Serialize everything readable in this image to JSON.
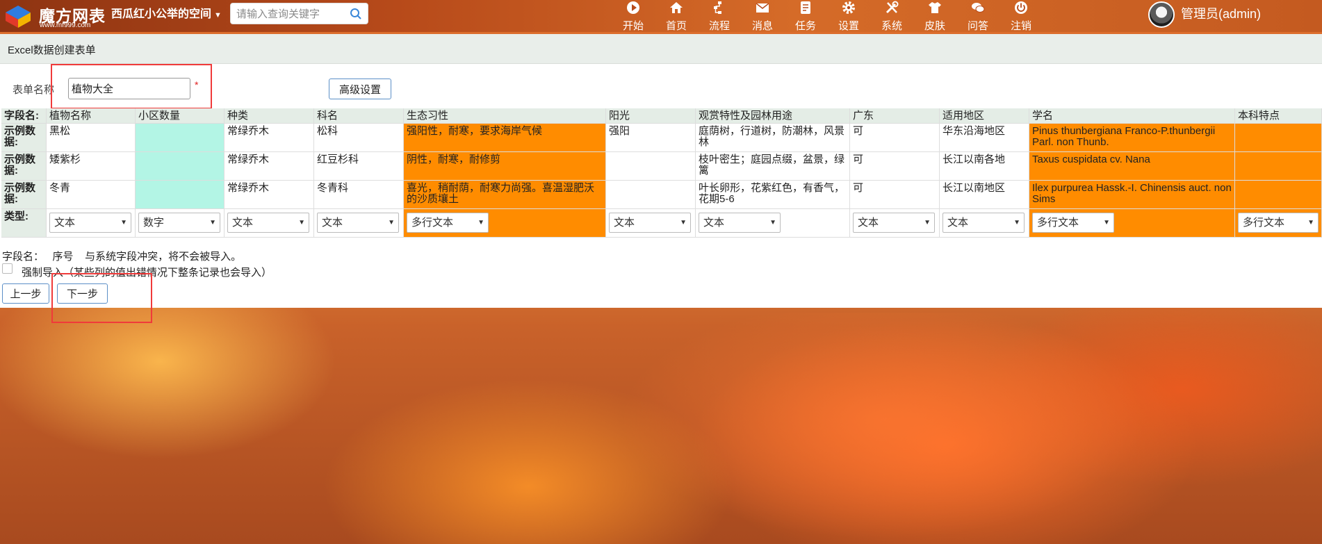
{
  "app": {
    "logo_title": "魔方网表",
    "logo_url": "www.mf999.com",
    "space_name": "西瓜红小公举的空间",
    "search_placeholder": "请输入查询关键字",
    "user_name": "管理员(admin)"
  },
  "nav": [
    {
      "label": "开始",
      "icon": "play-icon"
    },
    {
      "label": "首页",
      "icon": "home-icon"
    },
    {
      "label": "流程",
      "icon": "flow-icon"
    },
    {
      "label": "消息",
      "icon": "mail-icon"
    },
    {
      "label": "任务",
      "icon": "task-icon"
    },
    {
      "label": "设置",
      "icon": "gear-icon"
    },
    {
      "label": "系统",
      "icon": "tools-icon"
    },
    {
      "label": "皮肤",
      "icon": "shirt-icon"
    },
    {
      "label": "问答",
      "icon": "chat-icon"
    },
    {
      "label": "注销",
      "icon": "power-icon"
    }
  ],
  "breadcrumb": "Excel数据创建表单",
  "form": {
    "name_label": "表单名称",
    "name_value": "植物大全",
    "required_mark": "*",
    "advanced_button": "高级设置"
  },
  "table": {
    "row_labels": {
      "field": "字段名:",
      "sample": "示例数据:",
      "type": "类型:"
    },
    "columns": [
      {
        "name": "植物名称",
        "samples": [
          "黑松",
          "矮紫杉",
          "冬青"
        ],
        "type": "文本",
        "highlight": "none"
      },
      {
        "name": "小区数量",
        "samples": [
          "",
          "",
          ""
        ],
        "type": "数字",
        "highlight": "mint"
      },
      {
        "name": "种类",
        "samples": [
          "常绿乔木",
          "常绿乔木",
          "常绿乔木"
        ],
        "type": "文本",
        "highlight": "none"
      },
      {
        "name": "科名",
        "samples": [
          "松科",
          "红豆杉科",
          "冬青科"
        ],
        "type": "文本",
        "highlight": "none"
      },
      {
        "name": "生态习性",
        "samples": [
          "强阳性，耐寒，要求海岸气候",
          "阴性，耐寒，耐修剪",
          "喜光，稍耐荫，耐寒力尚强。喜温湿肥沃的沙质壤土"
        ],
        "type": "多行文本",
        "highlight": "orange"
      },
      {
        "name": "阳光",
        "samples": [
          "强阳",
          "",
          ""
        ],
        "type": "文本",
        "highlight": "none"
      },
      {
        "name": "观赏特性及园林用途",
        "samples": [
          "庭荫树，行道树，防潮林，风景林",
          "枝叶密生；庭园点缀，盆景，绿篱",
          "叶长卵形，花紫红色，有香气，花期5-6"
        ],
        "type": "文本",
        "highlight": "none"
      },
      {
        "name": "广东",
        "samples": [
          "可",
          "可",
          "可"
        ],
        "type": "文本",
        "highlight": "none"
      },
      {
        "name": "适用地区",
        "samples": [
          "华东沿海地区",
          "长江以南各地",
          "长江以南地区"
        ],
        "type": "文本",
        "highlight": "none"
      },
      {
        "name": "学名",
        "samples": [
          "Pinus thunbergiana Franco-P.thunbergii Parl. non Thunb.",
          "Taxus cuspidata cv. Nana",
          "Ilex purpurea Hassk.-I. Chinensis auct. non Sims"
        ],
        "type": "多行文本",
        "highlight": "orange"
      },
      {
        "name": "本科特点",
        "samples": [
          "",
          "",
          ""
        ],
        "type": "多行文本",
        "highlight": "orange"
      }
    ]
  },
  "notes": {
    "conflict": "字段名：   序号    与系统字段冲突，将不会被导入。",
    "force_import": "强制导入（某些列的值出错情况下整条记录也会导入）"
  },
  "buttons": {
    "prev": "上一步",
    "next": "下一步"
  },
  "colors": {
    "topbar": "#b74a1a",
    "orange_highlight": "#ff8c00",
    "mint_highlight": "#b3f5e5",
    "annotation_red": "#f03a3a"
  }
}
